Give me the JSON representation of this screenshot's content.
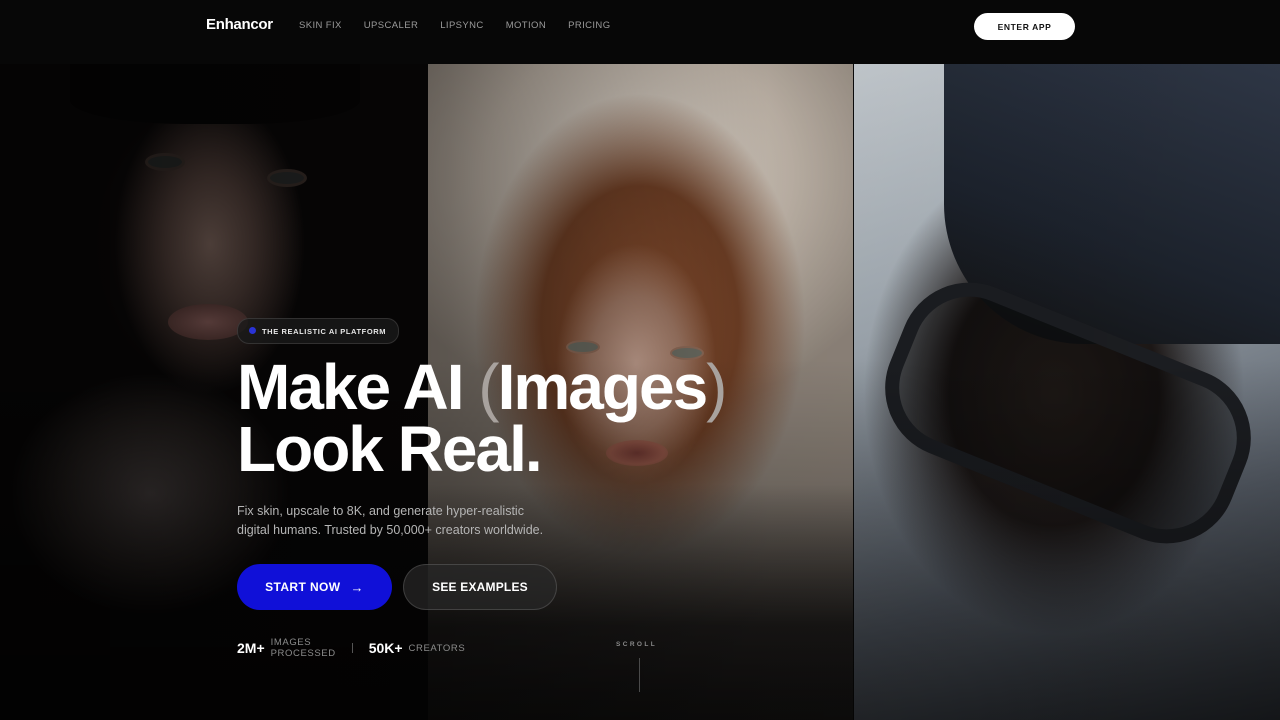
{
  "nav": {
    "logo": "Enhancor",
    "links": [
      {
        "label": "SKIN FIX"
      },
      {
        "label": "UPSCALER"
      },
      {
        "label": "LIPSYNC"
      },
      {
        "label": "MOTION"
      },
      {
        "label": "PRICING"
      }
    ],
    "cta": "ENTER APP"
  },
  "hero": {
    "badge": "THE REALISTIC AI PLATFORM",
    "headline": {
      "line1_pre": "Make AI ",
      "paren_open": "(",
      "line1_word": "Images",
      "paren_close": ")",
      "line2": "Look Real."
    },
    "subtitle": "Fix skin, upscale to 8K, and generate hyper-realistic digital humans. Trusted by 50,000+ creators worldwide.",
    "primary_cta": "START NOW",
    "primary_cta_icon": "→",
    "secondary_cta": "SEE EXAMPLES",
    "stats": [
      {
        "value": "2M+",
        "label": "IMAGES PROCESSED"
      },
      {
        "value": "50K+",
        "label": "CREATORS"
      }
    ],
    "scroll": "SCROLL"
  },
  "colors": {
    "accent": "#1010d8",
    "background": "#050505"
  }
}
